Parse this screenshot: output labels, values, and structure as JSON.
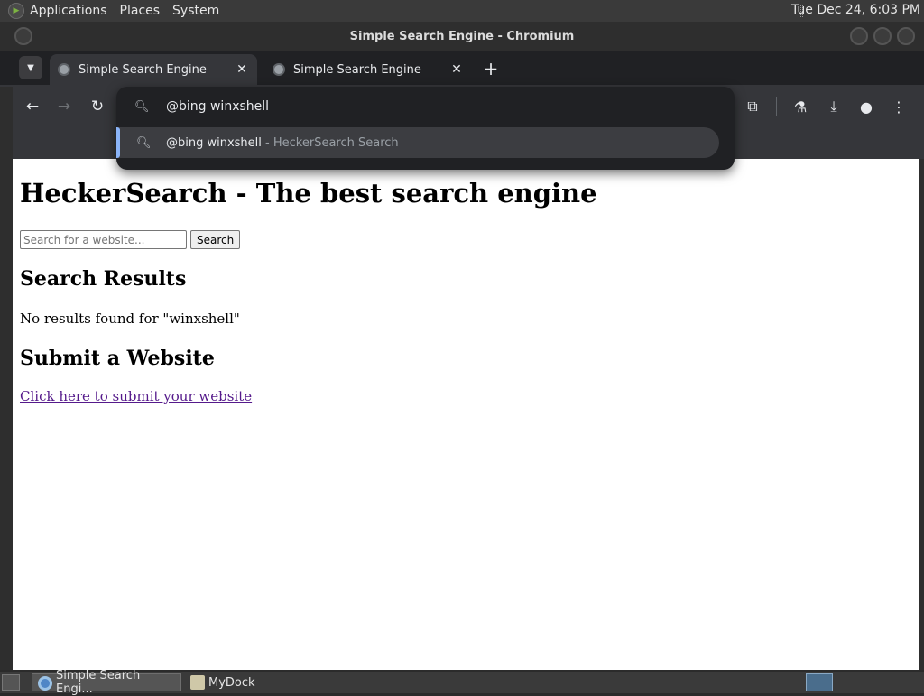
{
  "system_panel": {
    "menus": [
      "Applications",
      "Places",
      "System"
    ],
    "clock": "Tue Dec 24,  6:03 PM"
  },
  "window": {
    "title": "Simple Search Engine - Chromium"
  },
  "tabs": [
    {
      "title": "Simple Search Engine",
      "active": true
    },
    {
      "title": "Simple Search Engine",
      "active": false
    }
  ],
  "tab_close_glyph": "✕",
  "new_tab_glyph": "+",
  "omnibox": {
    "input_value": "@bing winxshell",
    "suggestion_text": "@bing winxshell",
    "suggestion_desc": " - HeckerSearch Search"
  },
  "page": {
    "heading": "HeckerSearch - The best search engine",
    "search_placeholder": "Search for a website...",
    "search_button": "Search",
    "results_heading": "Search Results",
    "no_results": "No results found for \"winxshell\"",
    "submit_heading": "Submit a Website",
    "submit_link": "Click here to submit your website"
  },
  "taskbar": {
    "tasks": [
      {
        "label": "Simple Search Engi...",
        "icon": "chromium-icon",
        "active": true
      },
      {
        "label": "MyDock",
        "icon": "folder-icon",
        "active": false
      }
    ]
  },
  "colors": {
    "accent": "#8ab4f8",
    "link_visited": "#551a8b"
  }
}
